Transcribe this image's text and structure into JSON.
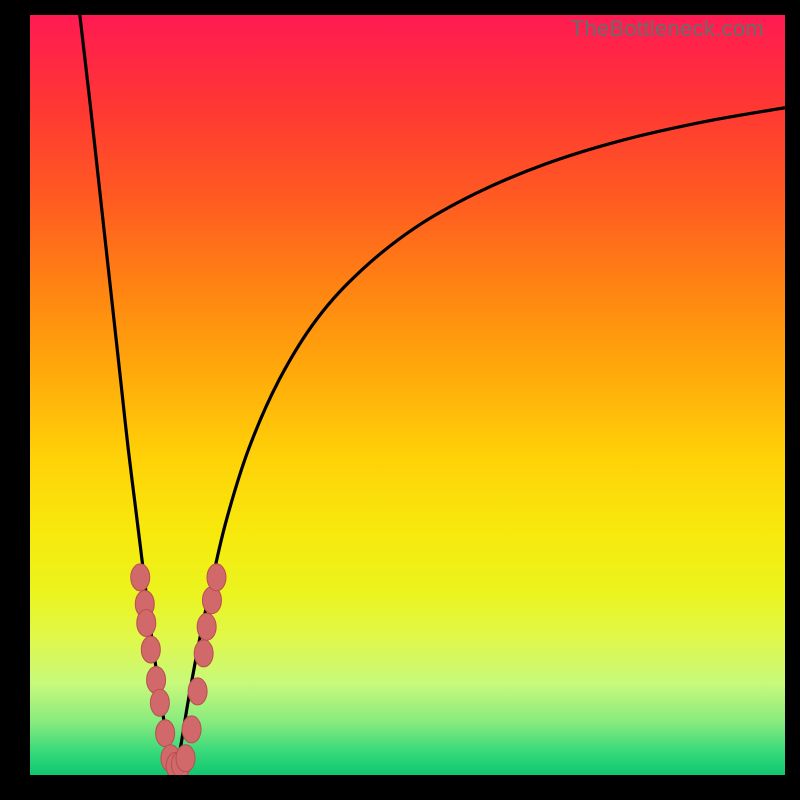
{
  "watermark": "TheBottleneck.com",
  "colors": {
    "frame_bg": "#000000",
    "curve": "#000000",
    "marker_fill": "#d1686a",
    "marker_stroke": "#b84e50",
    "gradient_top": "#ff1a52",
    "gradient_bottom": "#10c771"
  },
  "chart_data": {
    "type": "line",
    "title": "",
    "xlabel": "",
    "ylabel": "",
    "x_range": [
      0,
      100
    ],
    "y_range": [
      0,
      100
    ],
    "note": "Two branches of a bottleneck curve meeting near x≈19. Values estimated from pixels; y=0 at bottom, y=100 at top.",
    "series": [
      {
        "name": "left-branch",
        "x": [
          6.6,
          8,
          9,
          10,
          11,
          12,
          13,
          14,
          15,
          16,
          17,
          18,
          18.9
        ],
        "y": [
          100,
          88,
          79,
          70,
          61,
          52,
          43,
          35,
          27,
          19,
          12,
          5.5,
          0.5
        ]
      },
      {
        "name": "right-branch",
        "x": [
          19.3,
          20,
          21,
          22.5,
          24,
          26,
          29,
          33,
          38,
          44,
          51,
          59,
          68,
          78,
          89,
          100
        ],
        "y": [
          0.5,
          4,
          10,
          18,
          25,
          33.5,
          43,
          52,
          60,
          66.5,
          72,
          76.5,
          80.3,
          83.4,
          85.9,
          87.8
        ]
      }
    ],
    "markers_cluster": {
      "note": "Scatter of pink rounded markers clustered near the valley",
      "points": [
        {
          "x": 14.6,
          "y": 26
        },
        {
          "x": 15.2,
          "y": 22.5
        },
        {
          "x": 15.4,
          "y": 20
        },
        {
          "x": 16.0,
          "y": 16.5
        },
        {
          "x": 16.7,
          "y": 12.5
        },
        {
          "x": 17.2,
          "y": 9.5
        },
        {
          "x": 17.9,
          "y": 5.5
        },
        {
          "x": 18.6,
          "y": 2.2
        },
        {
          "x": 19.3,
          "y": 1.2
        },
        {
          "x": 20.0,
          "y": 1.4
        },
        {
          "x": 20.6,
          "y": 2.2
        },
        {
          "x": 21.4,
          "y": 6
        },
        {
          "x": 22.2,
          "y": 11
        },
        {
          "x": 23.0,
          "y": 16
        },
        {
          "x": 23.4,
          "y": 19.5
        },
        {
          "x": 24.1,
          "y": 23
        },
        {
          "x": 24.7,
          "y": 26
        }
      ]
    }
  }
}
